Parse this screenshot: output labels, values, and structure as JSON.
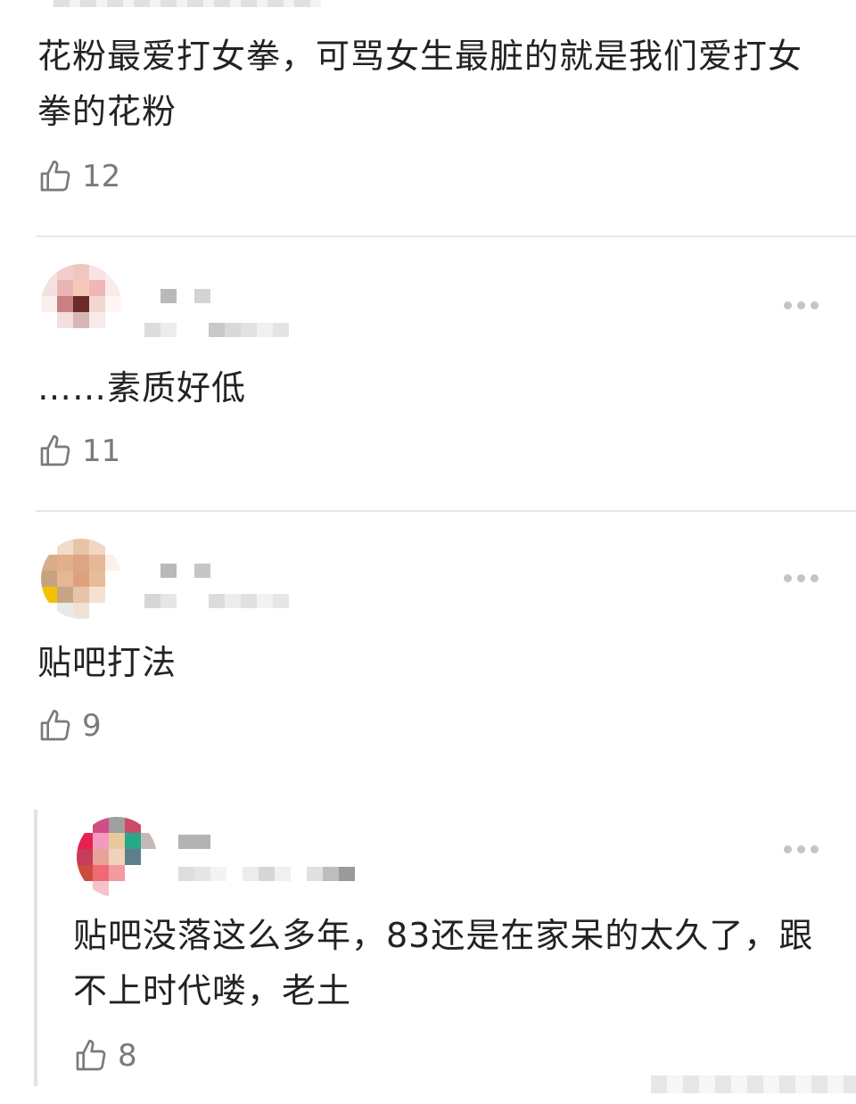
{
  "comments": [
    {
      "text": "花粉最爱打女拳，可骂女生最脏的就是我们爱打女拳的花粉",
      "likes": "12"
    },
    {
      "text": "……素质好低",
      "likes": "11"
    },
    {
      "text": "贴吧打法",
      "likes": "9"
    },
    {
      "text": "贴吧没落这么多年，83还是在家呆的太久了，跟不上时代喽，老土",
      "likes": "8"
    }
  ],
  "icons": {
    "like": "thumbs-up-icon",
    "more": "more-dots-icon"
  },
  "colors": {
    "text": "#222222",
    "meta": "#7a7a7a",
    "divider": "#e6e6e6"
  }
}
